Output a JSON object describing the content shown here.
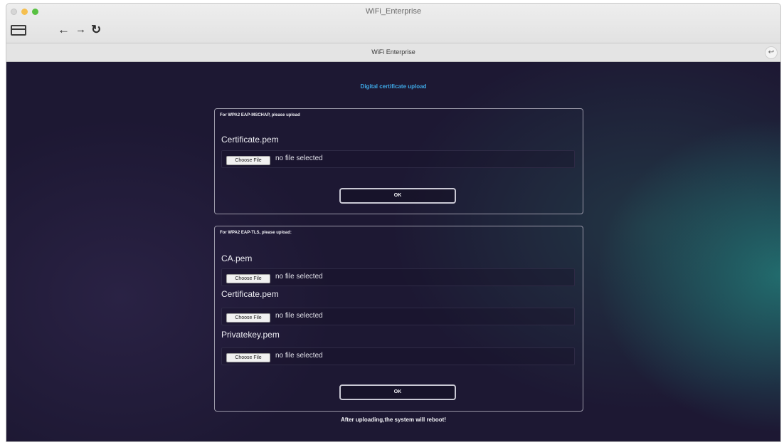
{
  "window": {
    "title": "WiFi_Enterprise"
  },
  "toolbar": {
    "sidebar_icon": "sidebar-icon",
    "back_icon": "←",
    "forward_icon": "→",
    "reload_icon": "↻"
  },
  "tab": {
    "title": "WiFi Enterprise",
    "action_icon": "↩"
  },
  "page": {
    "heading": "Digital certificate upload",
    "footer_note": "After uploading,the system will reboot!"
  },
  "panels": [
    {
      "title": "For WPA2 EAP-MSCHAP, please upload",
      "fields": [
        {
          "label": "Certificate.pem",
          "button": "Choose File",
          "status": "no file selected"
        }
      ],
      "ok_label": "OK"
    },
    {
      "title": "For WPA2 EAP-TLS, please upload:",
      "fields": [
        {
          "label": "CA.pem",
          "button": "Choose File",
          "status": "no file selected"
        },
        {
          "label": "Certificate.pem",
          "button": "Choose File",
          "status": "no file selected"
        },
        {
          "label": "Privatekey.pem",
          "button": "Choose File",
          "status": "no file selected"
        }
      ],
      "ok_label": "OK"
    }
  ],
  "colors": {
    "background": "#1d1833",
    "heading": "#3ea8e6",
    "teal_glow": "#227876"
  }
}
